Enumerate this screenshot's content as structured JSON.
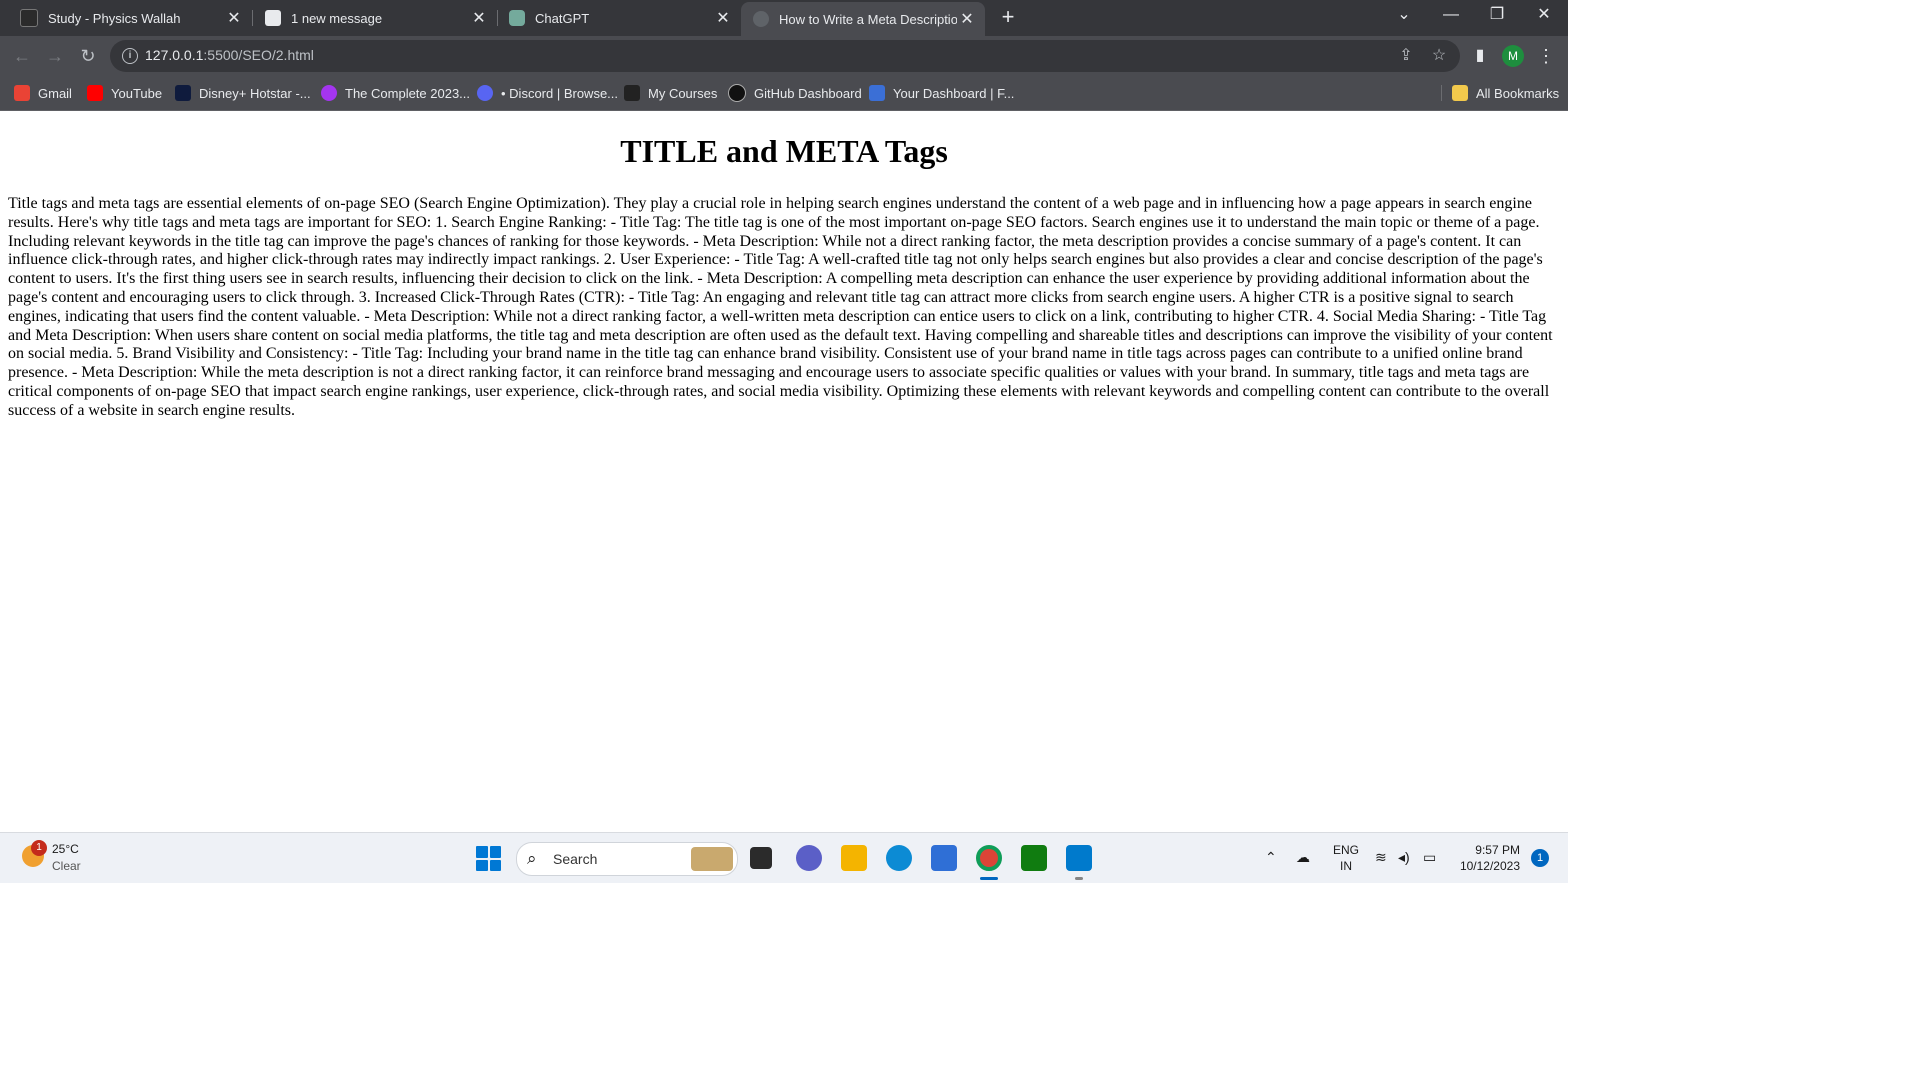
{
  "browser": {
    "tabs": [
      {
        "label": "Study - Physics Wallah",
        "icon": "physics-wallah-icon",
        "close": "✕"
      },
      {
        "label": "1 new message",
        "icon": "wordpress-icon",
        "close": "✕"
      },
      {
        "label": "ChatGPT",
        "icon": "chatgpt-icon",
        "close": "✕"
      },
      {
        "label": "How to Write a Meta Description",
        "icon": "loading-icon",
        "close": "✕"
      }
    ],
    "new_tab": "+",
    "window_controls": {
      "tab_search": "⌄",
      "minimize": "—",
      "restore": "❐",
      "close": "✕"
    },
    "nav": {
      "back": "←",
      "forward": "→",
      "reload": "↻"
    },
    "url": {
      "host": "127.0.0.1",
      "rest": ":5500/SEO/2.html",
      "site_info": "i"
    },
    "toolbar_icons": {
      "share": "⇪",
      "bookmark": "☆",
      "side_panel": "▮",
      "menu": "⋮"
    },
    "profile_initial": "M",
    "bookmarks": [
      {
        "label": "Gmail",
        "icon": "gmail-icon",
        "color": "#ea4335"
      },
      {
        "label": "YouTube",
        "icon": "youtube-icon",
        "color": "#ff0000"
      },
      {
        "label": "Disney+ Hotstar -...",
        "icon": "hotstar-icon",
        "color": "#0f1b3d"
      },
      {
        "label": "The Complete 2023...",
        "icon": "udemy-icon",
        "color": "#a435f0"
      },
      {
        "label": "• Discord | Browse...",
        "icon": "discord-icon",
        "color": "#5865f2"
      },
      {
        "label": "My Courses",
        "icon": "courses-icon",
        "color": "#222222"
      },
      {
        "label": "GitHub Dashboard",
        "icon": "github-icon",
        "color": "#111111"
      },
      {
        "label": "Your Dashboard | F...",
        "icon": "dashboard-icon",
        "color": "#3b6fd6"
      }
    ],
    "all_bookmarks": "All Bookmarks"
  },
  "page": {
    "heading": "TITLE and META Tags",
    "body": "Title tags and meta tags are essential elements of on-page SEO (Search Engine Optimization). They play a crucial role in helping search engines understand the content of a web page and in influencing how a page appears in search engine results. Here's why title tags and meta tags are important for SEO: 1. Search Engine Ranking: - Title Tag: The title tag is one of the most important on-page SEO factors. Search engines use it to understand the main topic or theme of a page. Including relevant keywords in the title tag can improve the page's chances of ranking for those keywords. - Meta Description: While not a direct ranking factor, the meta description provides a concise summary of a page's content. It can influence click-through rates, and higher click-through rates may indirectly impact rankings. 2. User Experience: - Title Tag: A well-crafted title tag not only helps search engines but also provides a clear and concise description of the page's content to users. It's the first thing users see in search results, influencing their decision to click on the link. - Meta Description: A compelling meta description can enhance the user experience by providing additional information about the page's content and encouraging users to click through. 3. Increased Click-Through Rates (CTR): - Title Tag: An engaging and relevant title tag can attract more clicks from search engine users. A higher CTR is a positive signal to search engines, indicating that users find the content valuable. - Meta Description: While not a direct ranking factor, a well-written meta description can entice users to click on a link, contributing to higher CTR. 4. Social Media Sharing: - Title Tag and Meta Description: When users share content on social media platforms, the title tag and meta description are often used as the default text. Having compelling and shareable titles and descriptions can improve the visibility of your content on social media. 5. Brand Visibility and Consistency: - Title Tag: Including your brand name in the title tag can enhance brand visibility. Consistent use of your brand name in title tags across pages can contribute to a unified online brand presence. - Meta Description: While the meta description is not a direct ranking factor, it can reinforce brand messaging and encourage users to associate specific qualities or values with your brand. In summary, title tags and meta tags are critical components of on-page SEO that impact search engine rankings, user experience, click-through rates, and social media visibility. Optimizing these elements with relevant keywords and compelling content can contribute to the overall success of a website in search engine results."
  },
  "taskbar": {
    "weather_badge": "1",
    "temperature": "25°C",
    "condition": "Clear",
    "search_label": "Search",
    "apps": [
      {
        "icon": "file-explorer-icon",
        "color": "#f4b400"
      },
      {
        "icon": "edge-icon",
        "color": "#0c8bd4"
      },
      {
        "icon": "store-icon",
        "color": "#2f6fd6"
      },
      {
        "icon": "chrome-icon",
        "color": "#db4437"
      },
      {
        "icon": "xbox-icon",
        "color": "#107c10"
      },
      {
        "icon": "vscode-icon",
        "color": "#007acc"
      }
    ],
    "language": {
      "line1": "ENG",
      "line2": "IN"
    },
    "time": "9:57 PM",
    "date": "10/12/2023",
    "notifications": "1"
  }
}
